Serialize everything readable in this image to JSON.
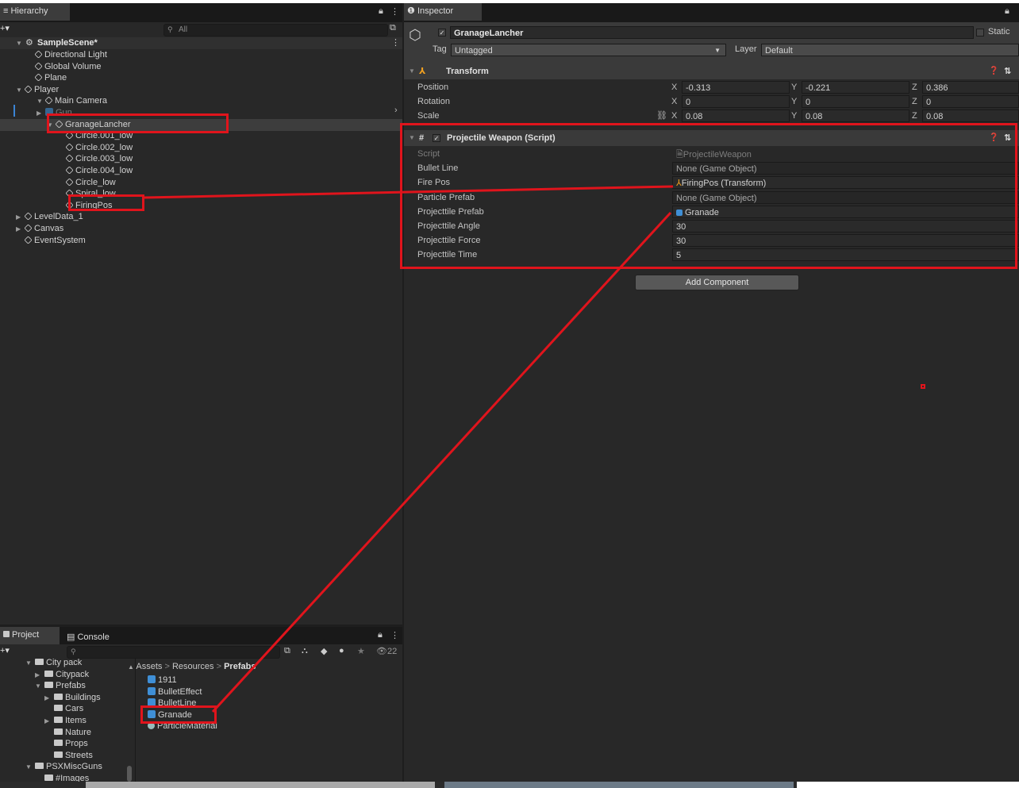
{
  "hierarchy": {
    "tab_label": "Hierarchy",
    "search_placeholder": "All",
    "scene_name": "SampleScene*",
    "items": [
      {
        "label": "Directional Light"
      },
      {
        "label": "Global Volume"
      },
      {
        "label": "Plane"
      },
      {
        "label": "Player"
      },
      {
        "label": "Main Camera"
      },
      {
        "label": "Gun"
      },
      {
        "label": "GranageLancher"
      },
      {
        "label": "Circle.001_low"
      },
      {
        "label": "Circle.002_low"
      },
      {
        "label": "Circle.003_low"
      },
      {
        "label": "Circle.004_low"
      },
      {
        "label": "Circle_low"
      },
      {
        "label": "Spiral_low"
      },
      {
        "label": "FiringPos"
      },
      {
        "label": "LevelData_1"
      },
      {
        "label": "Canvas"
      },
      {
        "label": "EventSystem"
      }
    ]
  },
  "inspector": {
    "tab_label": "Inspector",
    "object_name": "GranageLancher",
    "static_label": "Static",
    "tag_label": "Tag",
    "tag_value": "Untagged",
    "layer_label": "Layer",
    "layer_value": "Default",
    "transform": {
      "title": "Transform",
      "position_label": "Position",
      "rotation_label": "Rotation",
      "scale_label": "Scale",
      "axis_x": "X",
      "axis_y": "Y",
      "axis_z": "Z",
      "position": {
        "x": "-0.313",
        "y": "-0.221",
        "z": "0.386"
      },
      "rotation": {
        "x": "0",
        "y": "0",
        "z": "0"
      },
      "scale": {
        "x": "0.08",
        "y": "0.08",
        "z": "0.08"
      }
    },
    "script_component": {
      "title": "Projectile Weapon (Script)",
      "fields": [
        {
          "label": "Script",
          "value": "ProjectileWeapon"
        },
        {
          "label": "Bullet Line",
          "value": "None (Game Object)"
        },
        {
          "label": "Fire Pos",
          "value": "FiringPos (Transform)"
        },
        {
          "label": "Particle Prefab",
          "value": "None (Game Object)"
        },
        {
          "label": "Projecttile Prefab",
          "value": "Granade"
        },
        {
          "label": "Projecttile Angle",
          "value": "30"
        },
        {
          "label": "Projecttile Force",
          "value": "30"
        },
        {
          "label": "Projecttile Time",
          "value": "5"
        }
      ]
    },
    "add_component_label": "Add Component"
  },
  "project": {
    "tab_label": "Project",
    "console_tab_label": "Console",
    "hidden_count": "22",
    "breadcrumb": [
      "Assets",
      "Resources",
      "Prefabs"
    ],
    "tree": [
      {
        "label": "City pack"
      },
      {
        "label": "Citypack"
      },
      {
        "label": "Prefabs"
      },
      {
        "label": "Buildings"
      },
      {
        "label": "Cars"
      },
      {
        "label": "Items"
      },
      {
        "label": "Nature"
      },
      {
        "label": "Props"
      },
      {
        "label": "Streets"
      },
      {
        "label": "PSXMiscGuns"
      },
      {
        "label": "#Images"
      }
    ],
    "assets": [
      {
        "label": "1911"
      },
      {
        "label": "BulletEffect"
      },
      {
        "label": "BulletLine"
      },
      {
        "label": "Granade"
      },
      {
        "label": "ParticleMaterial"
      }
    ]
  },
  "colors": {
    "annotation": "#e0141c",
    "prefab_icon": "#3f8fd6"
  }
}
